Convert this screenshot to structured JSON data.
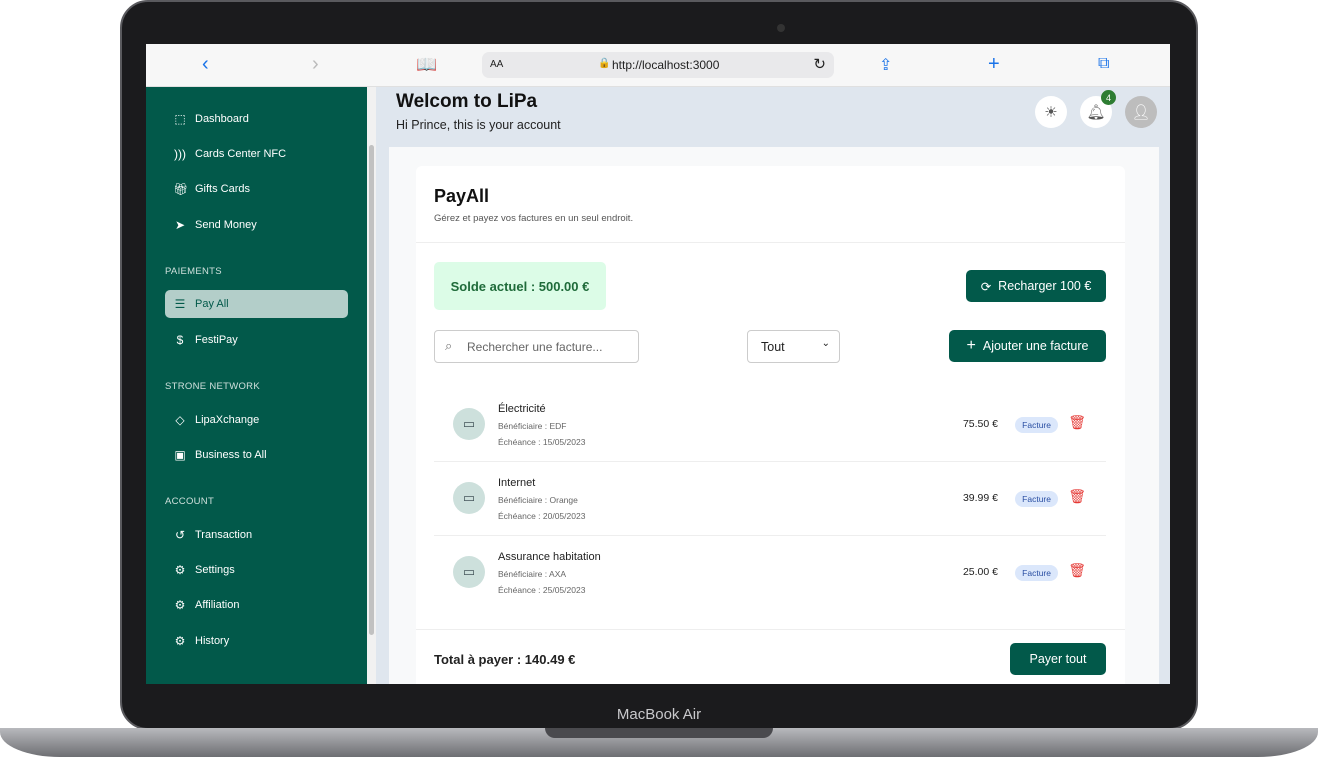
{
  "device": {
    "label": "MacBook Air"
  },
  "browser": {
    "text_size": "AA",
    "url": "http://localhost:3000"
  },
  "sidebar": {
    "items": [
      {
        "label": "Dashboard",
        "icon": "dashboard-icon"
      },
      {
        "label": "Cards Center NFC",
        "icon": "nfc-icon"
      },
      {
        "label": "Gifts Cards",
        "icon": "gift-icon"
      },
      {
        "label": "Send Money",
        "icon": "send-icon"
      }
    ],
    "sections": [
      {
        "title": "PAIEMENTS",
        "items": [
          {
            "label": "Pay All",
            "active": true
          },
          {
            "label": "FestiPay"
          }
        ]
      },
      {
        "title": "STRONE NETWORK",
        "items": [
          {
            "label": "LipaXchange"
          },
          {
            "label": "Business to All"
          }
        ]
      },
      {
        "title": "ACCOUNT",
        "items": [
          {
            "label": "Transaction"
          },
          {
            "label": "Settings"
          },
          {
            "label": "Affiliation"
          },
          {
            "label": "History"
          }
        ]
      }
    ]
  },
  "header": {
    "title": "Welcom to LiPa",
    "subtitle": "Hi Prince, this is your account",
    "notification_count": "4"
  },
  "payall": {
    "title": "PayAll",
    "subtitle": "Gérez et payez vos factures en un seul endroit.",
    "balance": "Solde actuel : 500.00 €",
    "recharge": "Recharger 100 €",
    "search_placeholder": "Rechercher une facture...",
    "filter": "Tout",
    "add": "Ajouter une facture",
    "bills": [
      {
        "name": "Électricité",
        "beneficiary": "Bénéficiaire : EDF",
        "due": "Échéance : 15/05/2023",
        "amount": "75.50 €",
        "tag": "Facture"
      },
      {
        "name": "Internet",
        "beneficiary": "Bénéficiaire : Orange",
        "due": "Échéance : 20/05/2023",
        "amount": "39.99 €",
        "tag": "Facture"
      },
      {
        "name": "Assurance habitation",
        "beneficiary": "Bénéficiaire : AXA",
        "due": "Échéance : 25/05/2023",
        "amount": "25.00 €",
        "tag": "Facture"
      }
    ],
    "total": "Total à payer : 140.49 €",
    "pay_all": "Payer tout"
  },
  "colors": {
    "brand": "#02594a",
    "active_item": "#b3cec9",
    "balance_bg": "#dcfce7",
    "danger": "#e53935"
  }
}
